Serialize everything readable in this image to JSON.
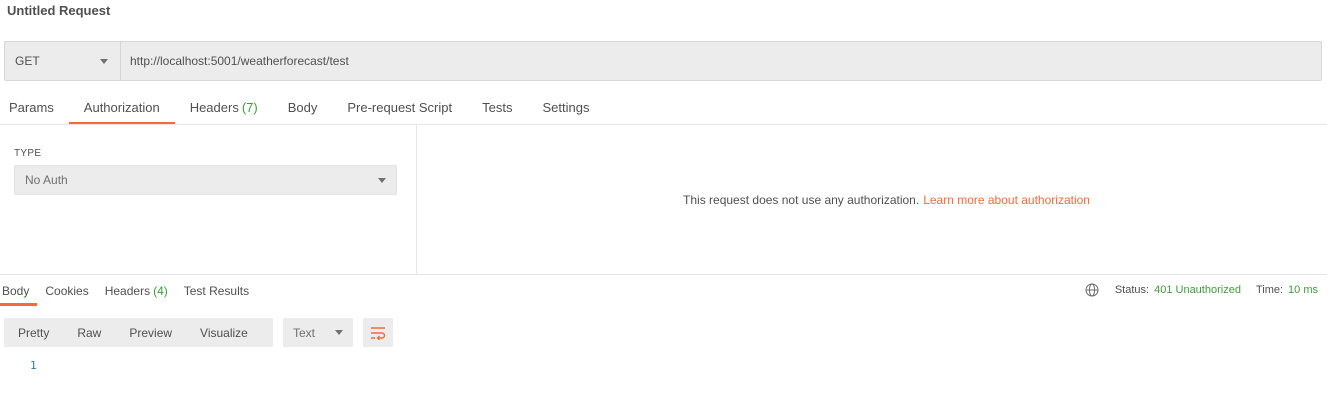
{
  "request": {
    "title": "Untitled Request",
    "method": "GET",
    "url": "http://localhost:5001/weatherforecast/test"
  },
  "request_tabs": {
    "params": "Params",
    "authorization": "Authorization",
    "headers": "Headers",
    "headers_count": "(7)",
    "body": "Body",
    "prerequest": "Pre-request Script",
    "tests": "Tests",
    "settings": "Settings",
    "active": "Authorization"
  },
  "auth": {
    "type_label": "TYPE",
    "type_value": "No Auth",
    "message": "This request does not use any authorization.",
    "link_text": "Learn more about authorization"
  },
  "response_tabs": {
    "body": "Body",
    "cookies": "Cookies",
    "headers": "Headers",
    "headers_count": "(4)",
    "test_results": "Test Results",
    "active": "Body"
  },
  "response_status": {
    "status_label": "Status:",
    "status_value": "401 Unauthorized",
    "time_label": "Time:",
    "time_value": "10 ms",
    "globe_icon": "globe-icon"
  },
  "response_view": {
    "pretty": "Pretty",
    "raw": "Raw",
    "preview": "Preview",
    "visualize": "Visualize",
    "format": "Text",
    "wrap_icon": "wrap-lines-icon"
  },
  "editor": {
    "line_number": "1"
  },
  "colors": {
    "accent": "#f26b3a",
    "success": "#3f9c3c",
    "line_number": "#2a7da0",
    "control_bg": "#ececec"
  }
}
